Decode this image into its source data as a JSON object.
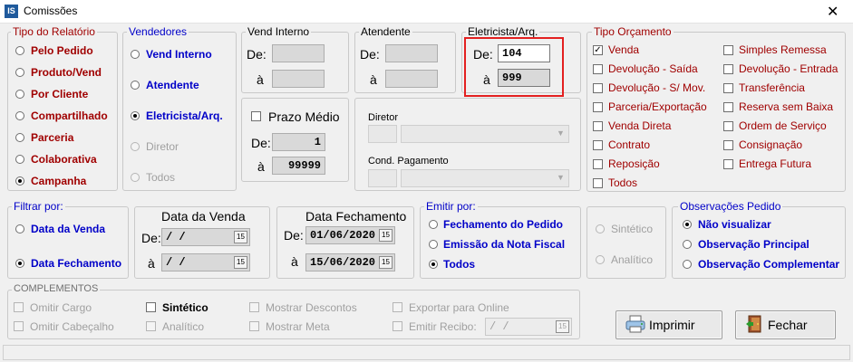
{
  "window": {
    "title": "Comissões",
    "icon_text": "IS",
    "close": "✕"
  },
  "tipo_relatorio": {
    "label": "Tipo do Relatório",
    "options": [
      "Pelo Pedido",
      "Produto/Vend",
      "Por Cliente",
      "Compartilhado",
      "Parceria",
      "Colaborativa",
      "Campanha"
    ],
    "selected": "Campanha"
  },
  "vendedores": {
    "label": "Vendedores",
    "options": [
      "Vend Interno",
      "Atendente",
      "Eletricista/Arq.",
      "Diretor",
      "Todos"
    ],
    "selected": "Eletricista/Arq."
  },
  "vend_interno": {
    "label": "Vend Interno",
    "de_label": "De:",
    "a_label": "à",
    "de": "",
    "a": ""
  },
  "atendente": {
    "label": "Atendente",
    "de_label": "De:",
    "a_label": "à",
    "de": "",
    "a": ""
  },
  "eletricista": {
    "label": "Eletricista/Arq.",
    "de_label": "De:",
    "a_label": "à",
    "de": "104",
    "a": "999",
    "highlight": "#e32020"
  },
  "prazo_medio": {
    "label": "Prazo Médio",
    "checked": false,
    "de_label": "De:",
    "a_label": "à",
    "de": "1",
    "a": "99999"
  },
  "diretor": {
    "label": "Diretor"
  },
  "cond_pagamento": {
    "label": "Cond. Pagamento"
  },
  "tipo_orcamento": {
    "label": "Tipo Orçamento",
    "col1": [
      "Venda",
      "Devolução - Saída",
      "Devolução - S/ Mov.",
      "Parceria/Exportação",
      "Venda Direta",
      "Contrato",
      "Reposição",
      "Todos"
    ],
    "col2": [
      "Simples Remessa",
      "Devolução - Entrada",
      "Transferência",
      "Reserva sem Baixa",
      "Ordem de Serviço",
      "Consignação",
      "Entrega Futura"
    ],
    "checked": [
      "Venda"
    ]
  },
  "filtrar_por": {
    "label": "Filtrar por:",
    "options": [
      "Data da Venda",
      "Data Fechamento"
    ],
    "selected": "Data Fechamento"
  },
  "data_venda": {
    "label": "Data da Venda",
    "de_label": "De:",
    "a_label": "à",
    "de": " / /",
    "a": " / /"
  },
  "data_fechamento": {
    "label": "Data Fechamento",
    "de_label": "De:",
    "a_label": "à",
    "de": "01/06/2020",
    "a": "15/06/2020"
  },
  "emitir_por": {
    "label": "Emitir por:",
    "options": [
      "Fechamento do Pedido",
      "Emissão da Nota Fiscal",
      "Todos"
    ],
    "selected": "Todos"
  },
  "sint_anal": {
    "options": [
      "Sintético",
      "Analítico"
    ]
  },
  "observacoes": {
    "label": "Observações Pedido",
    "options": [
      "Não visualizar",
      "Observação Principal",
      "Observação Complementar"
    ],
    "selected": "Não visualizar"
  },
  "complementos": {
    "label": "COMPLEMENTOS",
    "omitir_cargo": "Omitir Cargo",
    "omitir_cabecalho": "Omitir Cabeçalho",
    "sintetico": "Sintético",
    "analitico": "Analítico",
    "mostrar_descontos": "Mostrar Descontos",
    "mostrar_meta": "Mostrar Meta",
    "exportar_online": "Exportar para Online",
    "emitir_recibo": "Emitir Recibo:",
    "recibo_date": " / /"
  },
  "buttons": {
    "imprimir": "Imprimir",
    "fechar": "Fechar"
  },
  "icons": {
    "calendar": "15",
    "check": "✓",
    "dropdown": "▼"
  }
}
